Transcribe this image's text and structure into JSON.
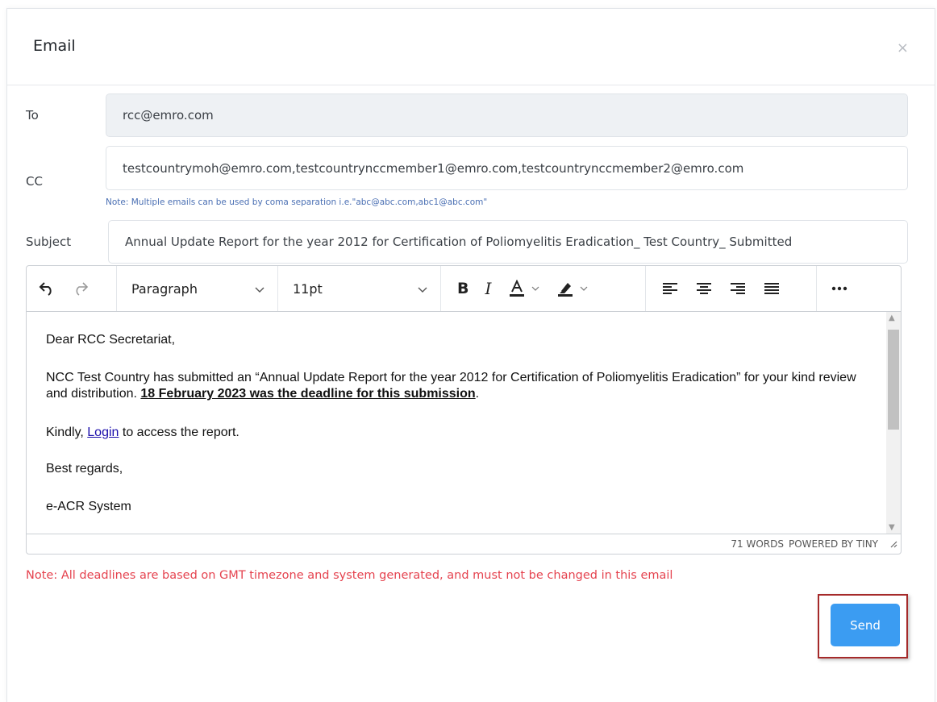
{
  "modal": {
    "title": "Email",
    "close_glyph": "×"
  },
  "form": {
    "to": {
      "label": "To",
      "value": "rcc@emro.com"
    },
    "cc": {
      "label": "CC",
      "value": "testcountrymoh@emro.com,testcountrynccmember1@emro.com,testcountrynccmember2@emro.com",
      "note": "Note: Multiple emails can be used by coma separation i.e.\"abc@abc.com,abc1@abc.com\""
    },
    "subject": {
      "label": "Subject",
      "value": "Annual Update Report for the year 2012 for Certification of Poliomyelitis Eradication_ Test Country_ Submitted"
    }
  },
  "editor": {
    "toolbar": {
      "block_format": "Paragraph",
      "font_size": "11pt",
      "icons": [
        "undo-icon",
        "redo-icon",
        "bold-icon",
        "italic-icon",
        "font-color-icon",
        "highlight-icon",
        "align-left-icon",
        "align-center-icon",
        "align-right-icon",
        "justify-icon",
        "more-icon"
      ]
    },
    "content": {
      "greeting": "Dear RCC Secretariat,",
      "body_prefix": "NCC Test Country has submitted an “Annual Update Report for the year 2012 for Certification of Poliomyelitis Eradication” for your kind review and distribution. ",
      "deadline": "18 February 2023 was the deadline for this submission",
      "body_suffix": ".",
      "kindly_prefix": "Kindly, ",
      "login_link": "Login",
      "kindly_suffix": " to access the report.",
      "closing": "Best regards,",
      "signature": "e-ACR System"
    },
    "status": {
      "word_count": "71 WORDS",
      "powered_by": "POWERED BY TINY"
    }
  },
  "footer_note": "Note: All deadlines are based on GMT timezone and system generated, and must not be changed in this email",
  "actions": {
    "send_label": "Send"
  },
  "colors": {
    "send_button": "#3b9cf2",
    "note_red": "#e5434f",
    "note_blue": "#4a6fb3",
    "highlight_frame": "#a52a2a"
  }
}
